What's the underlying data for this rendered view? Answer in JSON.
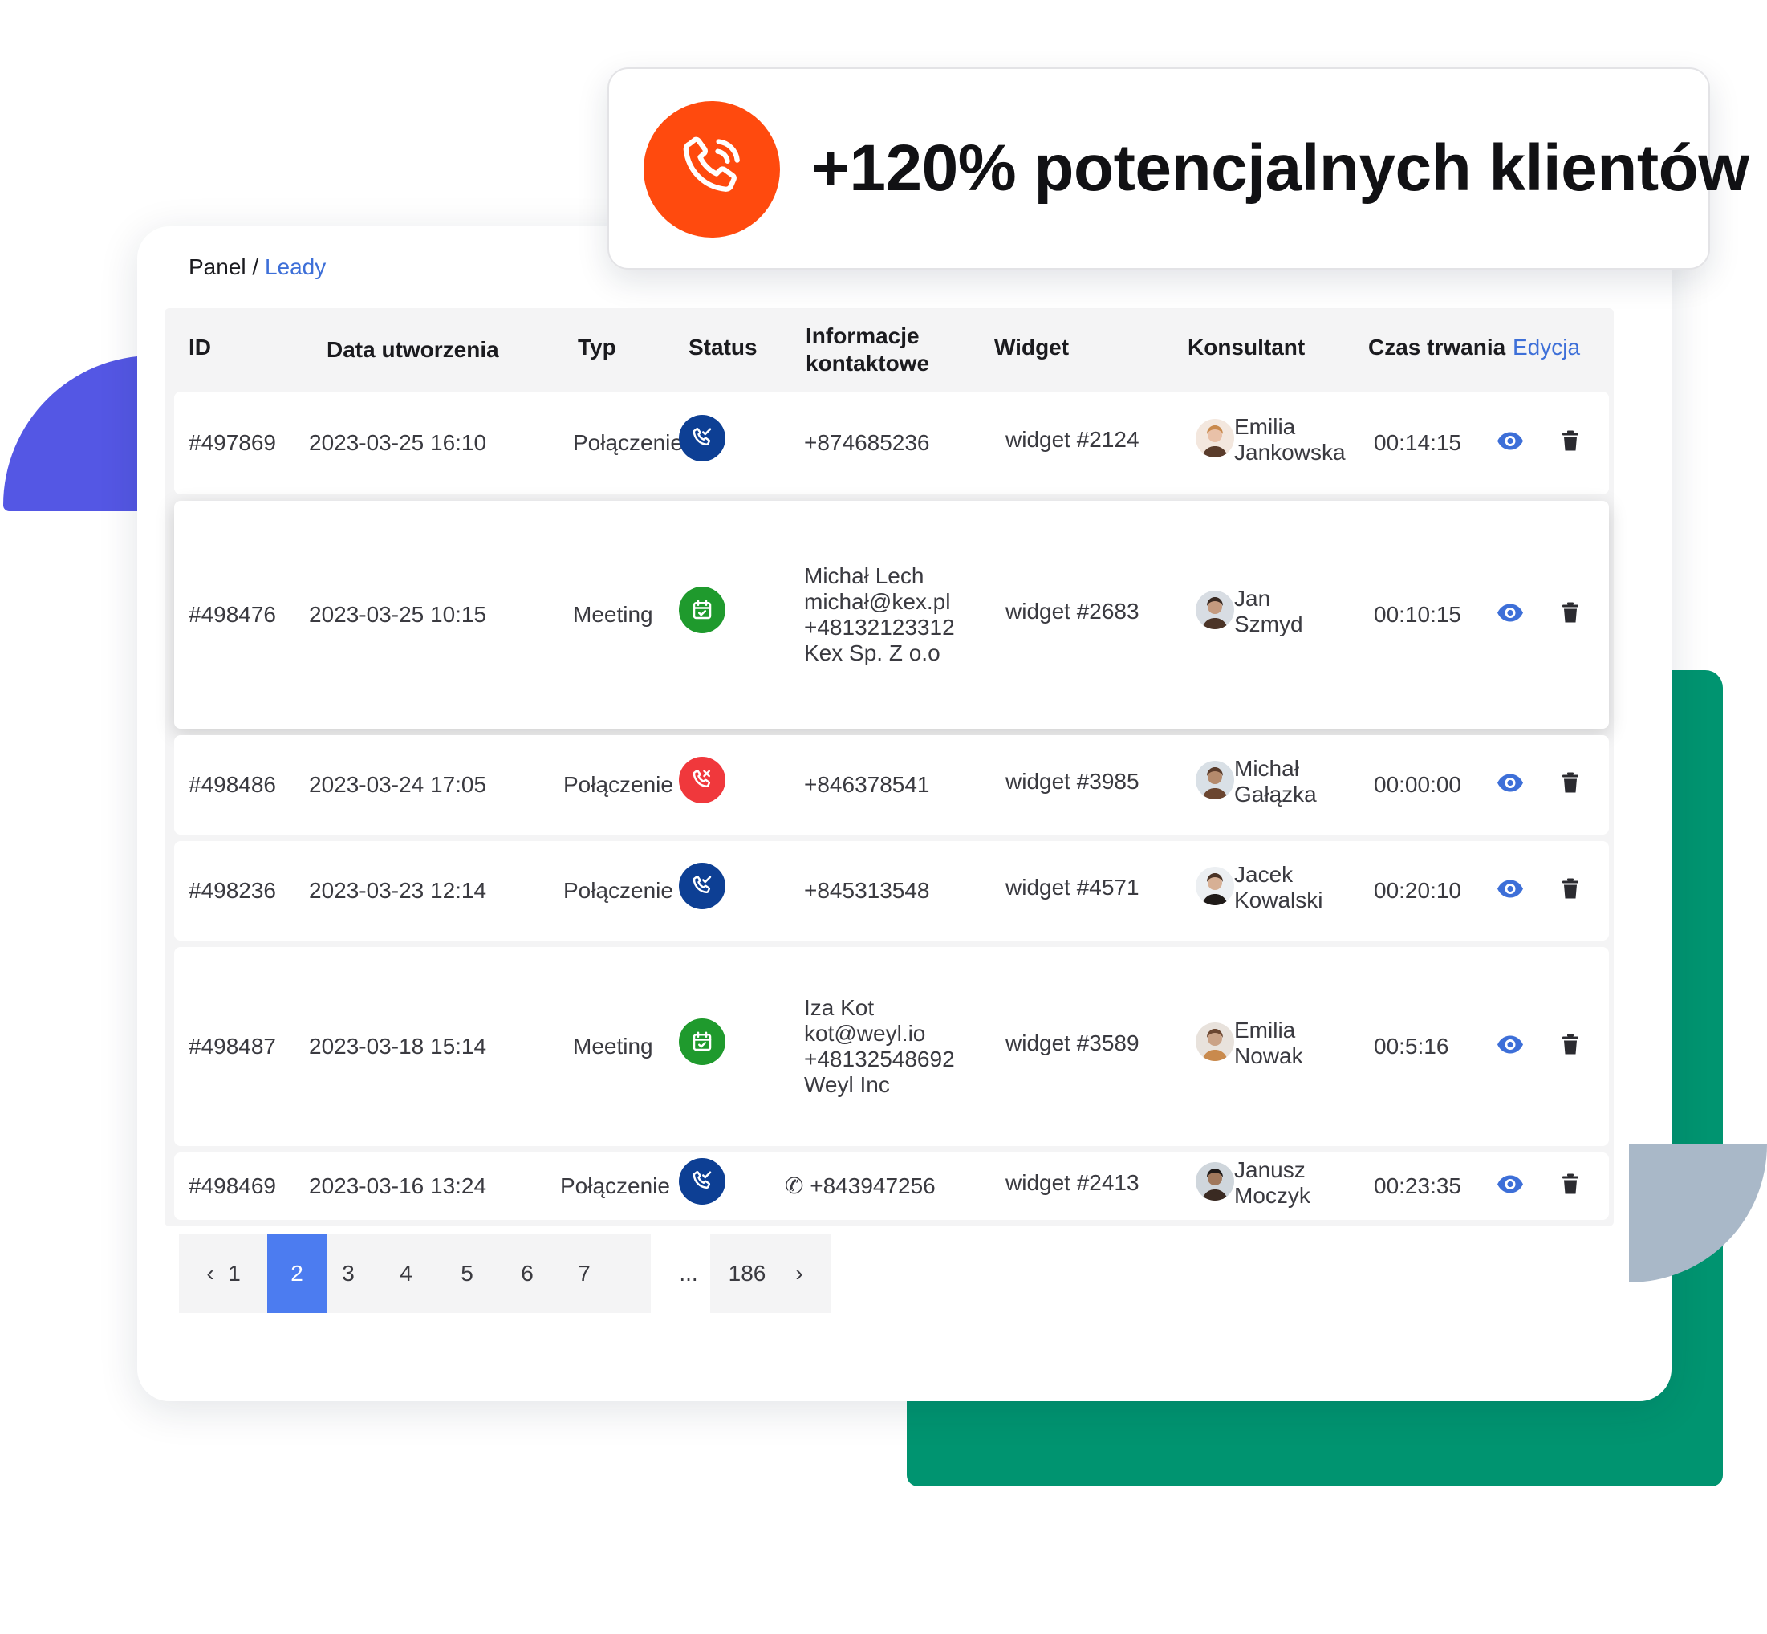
{
  "banner": {
    "text": "+120% potencjalnych klientów",
    "icon": "phone-ringing-icon"
  },
  "breadcrumb": {
    "root": "Panel",
    "separator": " / ",
    "current": "Leady"
  },
  "table": {
    "headers": {
      "id": "ID",
      "created": "Data utworzenia",
      "type": "Typ",
      "status": "Status",
      "contact_line1": "Informacje",
      "contact_line2": "kontaktowe",
      "widget": "Widget",
      "consultant": "Konsultant",
      "duration": "Czas trwania",
      "edit": "Edycja"
    },
    "rows": [
      {
        "id": "#497869",
        "created": "2023-03-25 16:10",
        "type": "Połączenie",
        "status": "call-answered",
        "contact": [
          "+874685236"
        ],
        "widget": "widget #2124",
        "consultant": [
          "Emilia",
          "Jankowska"
        ],
        "duration": "00:14:15"
      },
      {
        "id": "#498476",
        "created": "2023-03-25 10:15",
        "type": "Meeting",
        "status": "meeting",
        "contact": [
          "Michał Lech",
          "michał@kex.pl",
          "+48132123312",
          "Kex Sp. Z o.o"
        ],
        "widget": "widget #2683",
        "consultant": [
          "Jan",
          "Szmyd"
        ],
        "duration": "00:10:15"
      },
      {
        "id": "#498486",
        "created": "2023-03-24 17:05",
        "type": "Połączenie",
        "status": "call-missed",
        "contact": [
          "+846378541"
        ],
        "widget": "widget #3985",
        "consultant": [
          "Michał",
          "Gałązka"
        ],
        "duration": "00:00:00"
      },
      {
        "id": "#498236",
        "created": "2023-03-23 12:14",
        "type": "Połączenie",
        "status": "call-answered",
        "contact": [
          "+845313548"
        ],
        "widget": "widget #4571",
        "consultant": [
          "Jacek",
          "Kowalski"
        ],
        "duration": "00:20:10"
      },
      {
        "id": "#498487",
        "created": "2023-03-18 15:14",
        "type": "Meeting",
        "status": "meeting",
        "contact": [
          "Iza Kot",
          "kot@weyl.io",
          "+48132548692",
          "Weyl Inc"
        ],
        "widget": "widget #3589",
        "consultant": [
          "Emilia",
          "Nowak"
        ],
        "duration": "00:5:16"
      },
      {
        "id": "#498469",
        "created": "2023-03-16 13:24",
        "type": "Połączenie",
        "status": "call-answered",
        "contact": [
          "+843947256"
        ],
        "widget": "widget #2413",
        "consultant": [
          "Janusz",
          "Moczyk"
        ],
        "duration": "00:23:35"
      }
    ]
  },
  "pagination": {
    "prev": "‹",
    "next": "›",
    "pages": [
      "1",
      "2",
      "3",
      "4",
      "5",
      "6",
      "7"
    ],
    "ellipsis": "...",
    "last": "186",
    "active": "2"
  },
  "colors": {
    "accent_blue": "#3d6fd8",
    "call_answered": "#0d3f94",
    "call_missed": "#f0383c",
    "meeting": "#1f9a2d",
    "banner_orange": "#ff4a0e",
    "deco_purple": "#5457e4",
    "deco_green": "#009470",
    "deco_gray": "#a9b8c8",
    "active_page": "#4c7cf0"
  }
}
